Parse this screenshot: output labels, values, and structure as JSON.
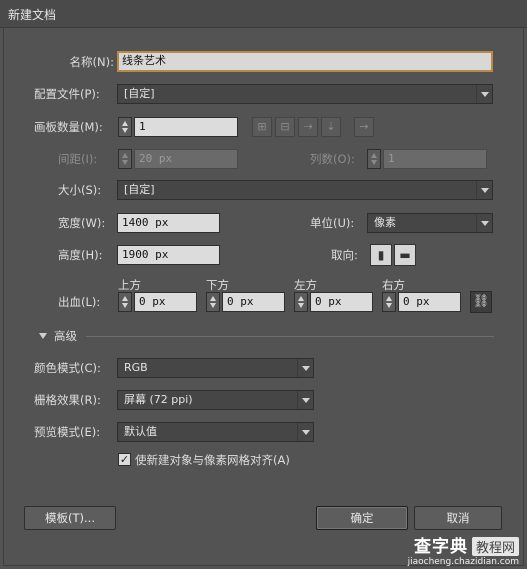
{
  "window": {
    "title": "新建文档"
  },
  "form": {
    "name_label": "名称(N):",
    "name_value": "线条艺术",
    "profile_label": "配置文件(P):",
    "profile_value": "[自定]",
    "artboards_label": "画板数量(M):",
    "artboards_value": "1",
    "spacing_label": "间距(I):",
    "spacing_value": "20 px",
    "columns_label": "列数(O):",
    "columns_value": "1",
    "size_label": "大小(S):",
    "size_value": "[自定]",
    "width_label": "宽度(W):",
    "width_value": "1400 px",
    "units_label": "单位(U):",
    "units_value": "像素",
    "height_label": "高度(H):",
    "height_value": "1900 px",
    "orientation_label": "取向:",
    "bleed_label": "出血(L):",
    "bleed": {
      "top_label": "上方",
      "top_value": "0 px",
      "bottom_label": "下方",
      "bottom_value": "0 px",
      "left_label": "左方",
      "left_value": "0 px",
      "right_label": "右方",
      "right_value": "0 px"
    },
    "advanced_label": "高级",
    "color_mode_label": "颜色模式(C):",
    "color_mode_value": "RGB",
    "raster_label": "栅格效果(R):",
    "raster_value": "屏幕 (72 ppi)",
    "preview_label": "预览模式(E):",
    "preview_value": "默认值",
    "align_checkbox_label": "使新建对象与像素网格对齐(A)",
    "align_checked": true
  },
  "buttons": {
    "templates": "模板(T)...",
    "ok": "确定",
    "cancel": "取消"
  },
  "watermark": {
    "line1": "查字典",
    "line1_box": "教程网",
    "line2": "jiaocheng.chazidian.com"
  }
}
